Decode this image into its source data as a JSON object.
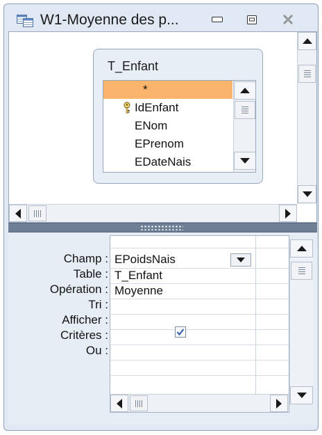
{
  "window": {
    "title": "W1-Moyenne des p...",
    "controls": {
      "minimize": "minimize-icon",
      "restore": "restore-icon",
      "close": "close-icon"
    }
  },
  "table_pane": {
    "table_name": "T_Enfant",
    "fields": [
      {
        "name": "*",
        "selected": true,
        "primary_key": false
      },
      {
        "name": "IdEnfant",
        "selected": false,
        "primary_key": true
      },
      {
        "name": "ENom",
        "selected": false,
        "primary_key": false
      },
      {
        "name": "EPrenom",
        "selected": false,
        "primary_key": false
      },
      {
        "name": "EDateNais",
        "selected": false,
        "primary_key": false
      }
    ]
  },
  "design_grid": {
    "row_labels": {
      "champ": "Champ :",
      "table": "Table :",
      "operation": "Opération :",
      "tri": "Tri :",
      "afficher": "Afficher :",
      "criteres": "Critères :",
      "ou": "Ou :"
    },
    "column1": {
      "champ": "EPoidsNais",
      "table": "T_Enfant",
      "operation": "Moyenne",
      "tri": "",
      "afficher_checked": true,
      "criteres": "",
      "ou": ""
    }
  },
  "colors": {
    "selected_field": "#fbb46b",
    "splitter": "#6e7e95",
    "window_frame": "#dfe8f3"
  }
}
